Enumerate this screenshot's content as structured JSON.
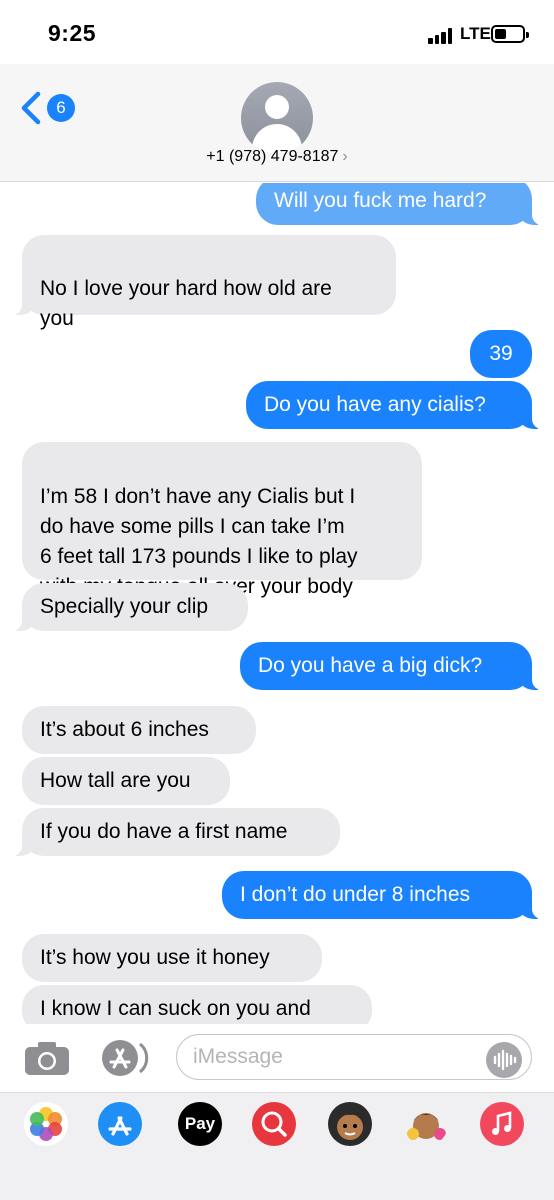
{
  "status_bar": {
    "time": "9:25",
    "network": "LTE"
  },
  "header": {
    "back_count": "6",
    "contact_name": "+1 (978) 479-8187",
    "chevron": "›"
  },
  "messages": [
    {
      "dir": "out",
      "text": "Will you fuck me hard?"
    },
    {
      "dir": "in",
      "text": "No I love your hard how old are\nyou"
    },
    {
      "dir": "out",
      "text": "39"
    },
    {
      "dir": "out",
      "text": "Do you have any cialis?"
    },
    {
      "dir": "in",
      "text": "I’m 58 I don’t have any Cialis but I\ndo have some pills I can take I’m\n6 feet tall 173 pounds I like to play\nwith my tongue all over your body"
    },
    {
      "dir": "in",
      "text": "Specially your clip"
    },
    {
      "dir": "out",
      "text": "Do you have a big dick?"
    },
    {
      "dir": "in",
      "text": "It’s about 6 inches"
    },
    {
      "dir": "in",
      "text": "How tall are you"
    },
    {
      "dir": "in",
      "text": "If you do have a first name"
    },
    {
      "dir": "out",
      "text": "I don’t do under 8 inches"
    },
    {
      "dir": "in",
      "text": "It’s how you use it honey"
    },
    {
      "dir": "in",
      "text": "I know I can suck on you and"
    }
  ],
  "compose": {
    "placeholder": "iMessage"
  },
  "app_strip": {
    "apps": [
      {
        "name": "photos-app-icon"
      },
      {
        "name": "app-store-app-icon"
      },
      {
        "name": "apple-pay-app-icon",
        "label": "Pay"
      },
      {
        "name": "search-images-app-icon"
      },
      {
        "name": "memoji-app-icon"
      },
      {
        "name": "memoji-stickers-app-icon"
      },
      {
        "name": "music-app-icon"
      }
    ]
  },
  "colors": {
    "outgoing": "#1982fc",
    "incoming": "#e9e9eb",
    "accent": "#1982fc"
  }
}
